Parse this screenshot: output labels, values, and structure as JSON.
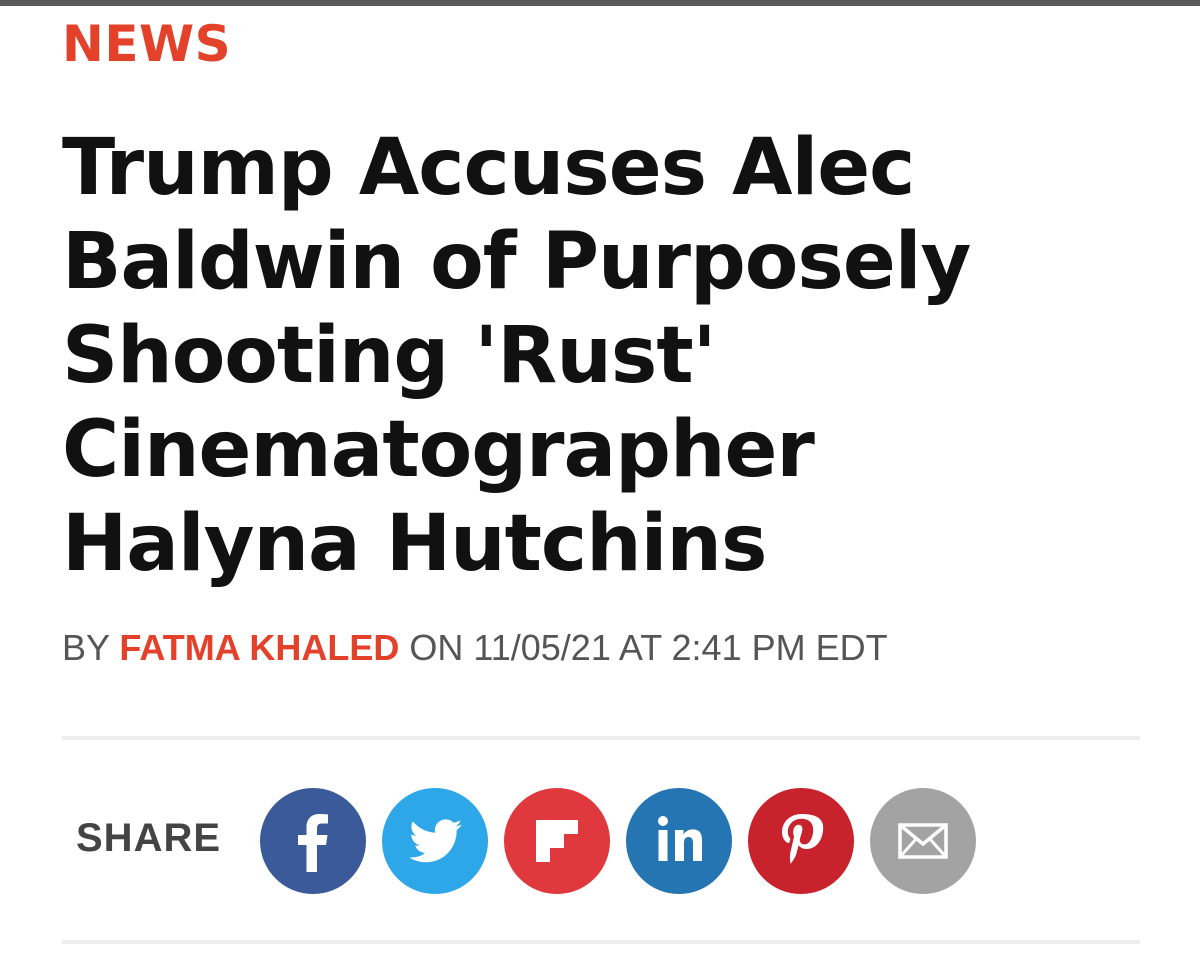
{
  "section": {
    "label": "NEWS"
  },
  "article": {
    "headline_lines": [
      "Trump Accuses Alec",
      "Baldwin of Purposely",
      "Shooting 'Rust'",
      "Cinematographer",
      "Halyna Hutchins"
    ],
    "byline": {
      "prefix": "BY",
      "author": "FATMA KHALED",
      "suffix": "ON 11/05/21 AT 2:41 PM EDT"
    }
  },
  "share": {
    "label": "SHARE",
    "buttons": [
      {
        "network": "facebook",
        "icon": "facebook-icon",
        "color": "#3b5a9a",
        "glyph": "f"
      },
      {
        "network": "twitter",
        "icon": "twitter-icon",
        "color": "#2ea7e9"
      },
      {
        "network": "flipboard",
        "icon": "flipboard-icon",
        "color": "#e0393d"
      },
      {
        "network": "linkedin",
        "icon": "linkedin-icon",
        "color": "#2475b2",
        "glyph": "in"
      },
      {
        "network": "pinterest",
        "icon": "pinterest-icon",
        "color": "#c8232c",
        "glyph": "P"
      },
      {
        "network": "email",
        "icon": "mail-icon",
        "color": "#a3a3a3"
      }
    ]
  },
  "colors": {
    "accent": "#e4412b",
    "headline": "#111111",
    "byline": "#555555"
  }
}
